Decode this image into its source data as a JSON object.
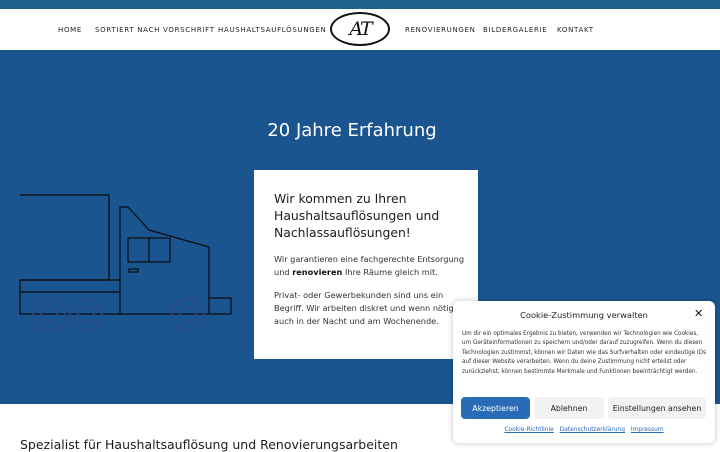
{
  "nav": {
    "items": [
      "HOME",
      "SORTIERT NACH VORSCHRIFT",
      "HAUSHALTSAUFLÖSUNGEN",
      "RENOVIERUNGEN",
      "BILDERGALERIE",
      "KONTAKT"
    ],
    "logo_text": "AT"
  },
  "hero": {
    "title": "20 Jahre Erfahrung",
    "card": {
      "heading": "Wir kommen zu Ihren Haushaltsauflösungen und Nachlassauflösungen!",
      "p1_before": "Wir garantieren eine fachgerechte Entsorgung und ",
      "p1_bold": "renovieren",
      "p1_after": " Ihre Räume gleich mit.",
      "p2": "Privat- oder Gewerbekunden sind uns ein Begriff. Wir arbeiten diskret und wenn nötig, auch in der Nacht und am Wochenende."
    }
  },
  "section": {
    "title": "Spezialist für Haushaltsauflösung und Renovierungsarbeiten"
  },
  "cookie": {
    "title": "Cookie-Zustimmung verwalten",
    "text": "Um dir ein optimales Ergebnis zu bieten, verwenden wir Technologien wie Cookies, um Geräteinformationen zu speichern und/oder darauf zuzugreifen. Wenn du diesen Technologien zustimmst, können wir Daten wie das Surfverhalten oder eindeutige IDs auf dieser Website verarbeiten. Wenn du deine Zustimmung nicht erteilst oder zurückziehst, können bestimmte Merkmale und Funktionen beeinträchtigt werden.",
    "accept": "Akzeptieren",
    "deny": "Ablehnen",
    "prefs": "Einstellungen ansehen",
    "links": [
      "Cookie-Richtlinie",
      "Datenschutzerklärung",
      "Impressum"
    ]
  },
  "colors": {
    "hero_bg": "#1a5590",
    "top_strip": "#1d6389",
    "accent_button": "#2a6bb8"
  }
}
